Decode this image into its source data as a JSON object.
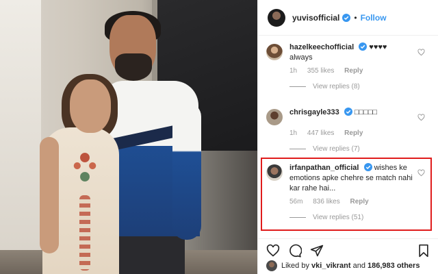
{
  "post": {
    "username": "yuvisofficial",
    "separator": "•",
    "follow_label": "Follow"
  },
  "comments": [
    {
      "username": "hazelkeechofficial",
      "verified": true,
      "text": "♥♥♥♥",
      "text_line2": "always",
      "time": "1h",
      "likes": "355 likes",
      "reply_label": "Reply",
      "view_replies": "View replies (8)"
    },
    {
      "username": "chrisgayle333",
      "verified": true,
      "text": "□□□□□",
      "time": "1h",
      "likes": "447 likes",
      "reply_label": "Reply",
      "view_replies": "View replies (7)"
    },
    {
      "username": "irfanpathan_official",
      "verified": true,
      "text": "wishes ke emotions apke chehre se match nahi kar rahe hai...",
      "time": "56m",
      "likes": "836 likes",
      "reply_label": "Reply",
      "view_replies": "View replies (51)"
    }
  ],
  "likes_bar": {
    "prefix": "Liked by ",
    "user": "vki_vikrant",
    "connector": " and ",
    "count": "186,983 others"
  },
  "icons": {
    "like": "heart-icon",
    "comment": "comment-icon",
    "share": "share-icon",
    "save": "bookmark-icon",
    "verified": "verified-badge-icon"
  },
  "colors": {
    "accent": "#3897f0",
    "highlight": "#e01b1b",
    "muted": "#999999"
  }
}
